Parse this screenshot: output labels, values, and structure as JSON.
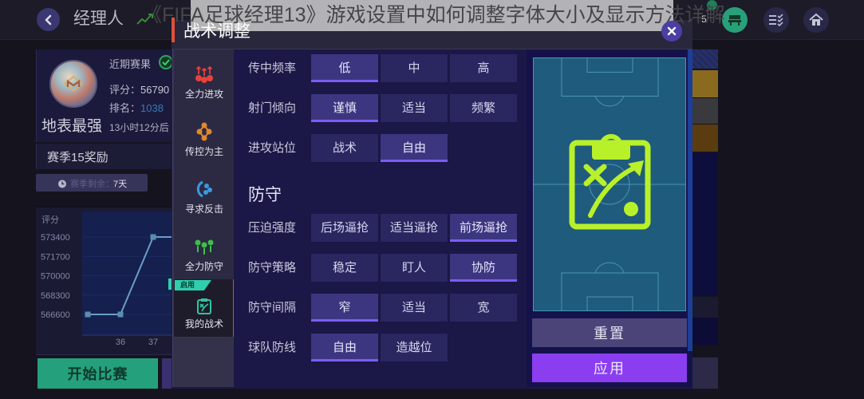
{
  "overlay_title": "《FIFA足球经理13》游戏设置中如何调整字体大小及显示方法详解",
  "top_bar": {
    "title": "经理人",
    "notification_count": "5",
    "icons": {
      "back": "chevron-left-icon",
      "trend": "trend-icon",
      "bench": "bench-icon",
      "tasks": "checklist-icon",
      "home": "home-icon"
    }
  },
  "profile": {
    "recent_results_label": "近期赛果",
    "rating_label": "评分：",
    "rating_value": "56790",
    "rank_label": "排名：",
    "rank_value": "1038",
    "countdown": "13小时12分后",
    "team_name": "地表最强"
  },
  "season": {
    "reward_label": "赛季15奖励",
    "remaining_label": "赛季剩余：",
    "remaining_value": "7天"
  },
  "rating_chart": {
    "type": "line",
    "ylabel": "评分",
    "ylim": [
      566600,
      573400
    ],
    "y_ticks": [
      573400,
      571700,
      570000,
      568300,
      566600
    ],
    "x_tick_labels": [
      {
        "x": 36,
        "label": "36"
      },
      {
        "x": 37,
        "label": "37"
      }
    ],
    "points": [
      {
        "x": 35,
        "y": 566600
      },
      {
        "x": 36,
        "y": 566600
      },
      {
        "x": 37,
        "y": 573400
      },
      {
        "x": 38,
        "y": 573400
      }
    ]
  },
  "start_button": "开始比赛",
  "modal": {
    "title": "战术调整",
    "presets": [
      {
        "label": "全力进攻",
        "icon": "attack-icon",
        "selected": false
      },
      {
        "label": "传控为主",
        "icon": "possession-icon",
        "selected": false
      },
      {
        "label": "寻求反击",
        "icon": "counter-attack-icon",
        "selected": false
      },
      {
        "label": "全力防守",
        "icon": "defend-icon",
        "selected": false
      },
      {
        "label": "我的战术",
        "icon": "clipboard-icon",
        "badge": "启用",
        "selected": true
      }
    ],
    "attack_rows": [
      {
        "label": "传中频率",
        "options": [
          "低",
          "中",
          "高"
        ],
        "selected": 0
      },
      {
        "label": "射门倾向",
        "options": [
          "谨慎",
          "适当",
          "频繁"
        ],
        "selected": 0
      },
      {
        "label": "进攻站位",
        "options": [
          "战术",
          "自由"
        ],
        "selected": 1
      }
    ],
    "defense_heading": "防守",
    "defense_rows": [
      {
        "label": "压迫强度",
        "options": [
          "后场逼抢",
          "适当逼抢",
          "前场逼抢"
        ],
        "selected": 2
      },
      {
        "label": "防守策略",
        "options": [
          "稳定",
          "盯人",
          "协防"
        ],
        "selected": 2
      },
      {
        "label": "防守间隔",
        "options": [
          "窄",
          "适当",
          "宽"
        ],
        "selected": 0
      },
      {
        "label": "球队防线",
        "options": [
          "自由",
          "造越位"
        ],
        "selected": 0
      }
    ],
    "reset_label": "重置",
    "apply_label": "应用"
  },
  "colors": {
    "selected_underline": "#7b5df5",
    "apply_purple": "#8a3ef0",
    "start_green": "#25a07c",
    "pitch": "#1f5b7c",
    "tactic_icon": "#b8f02a",
    "active_badge": "#2fcfae",
    "selected_preset_border": "#d84a3a"
  }
}
